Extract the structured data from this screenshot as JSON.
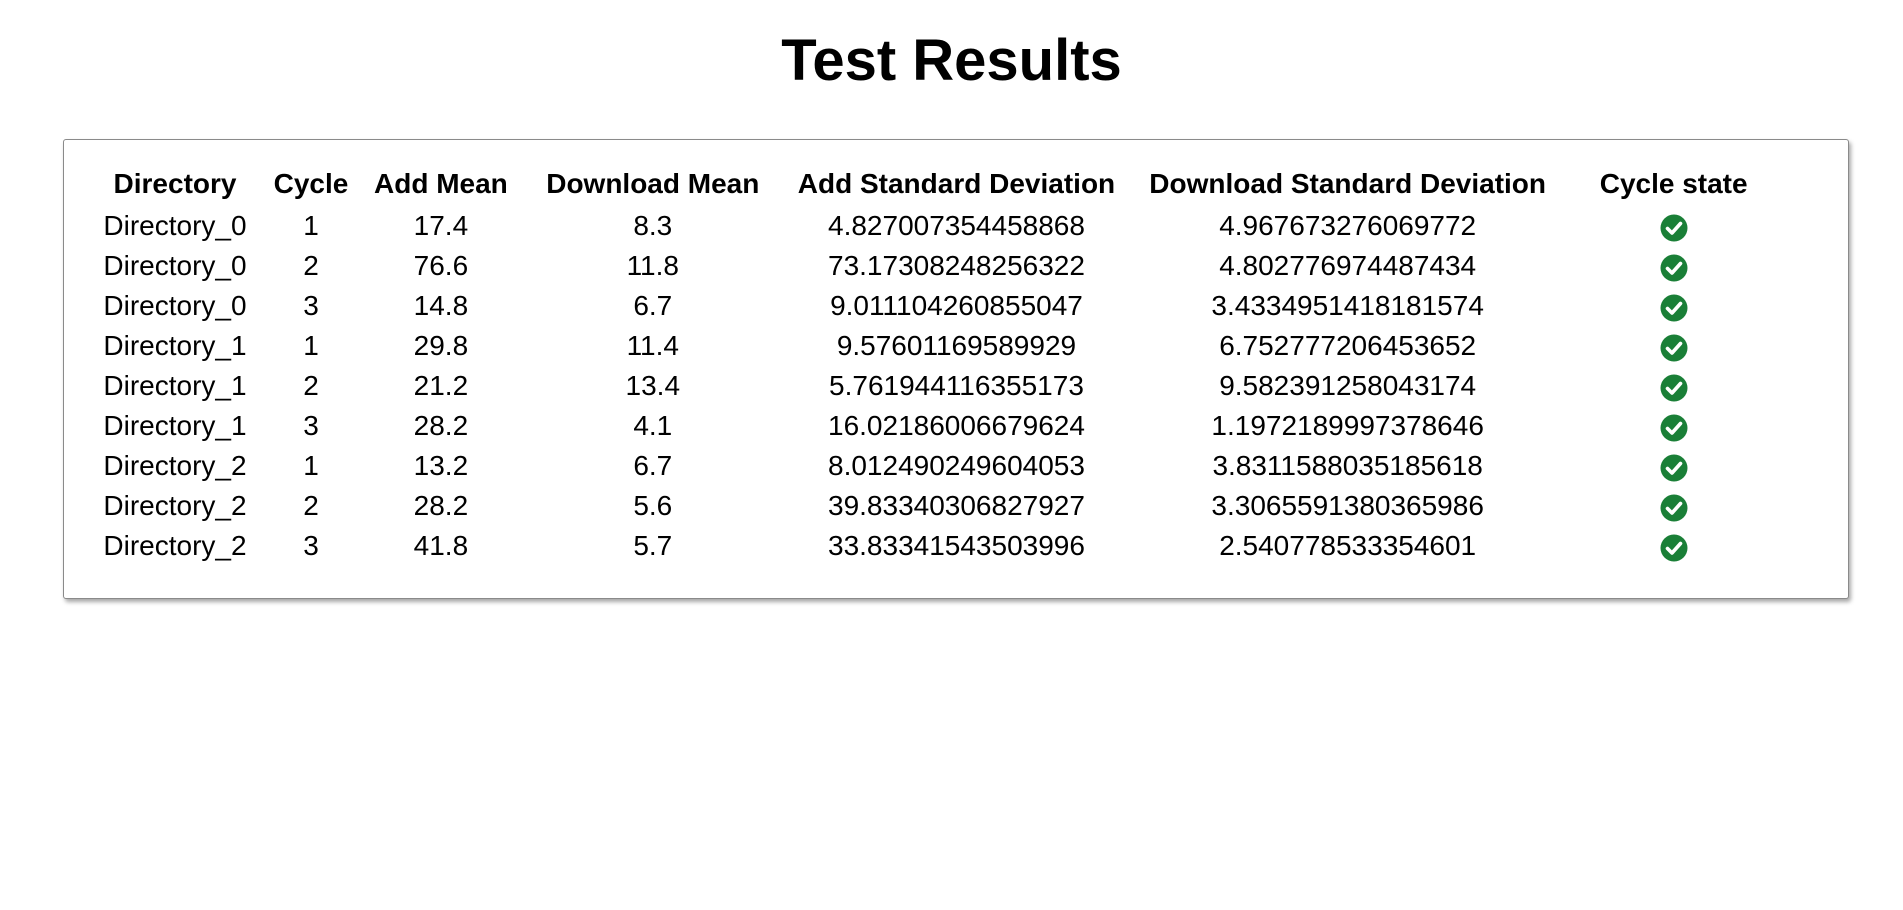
{
  "page": {
    "title": "Test Results"
  },
  "table": {
    "columns": [
      "Directory",
      "Cycle",
      "Add Mean",
      "Download Mean",
      "Add Standard Deviation",
      "Download Standard Deviation",
      "Cycle state"
    ],
    "rows": [
      [
        "Directory_0",
        "1",
        "17.4",
        "8.3",
        "4.827007354458868",
        "4.967673276069772",
        "check-circle-icon"
      ],
      [
        "Directory_0",
        "2",
        "76.6",
        "11.8",
        "73.17308248256322",
        "4.802776974487434",
        "check-circle-icon"
      ],
      [
        "Directory_0",
        "3",
        "14.8",
        "6.7",
        "9.011104260855047",
        "3.4334951418181574",
        "check-circle-icon"
      ],
      [
        "Directory_1",
        "1",
        "29.8",
        "11.4",
        "9.57601169589929",
        "6.752777206453652",
        "check-circle-icon"
      ],
      [
        "Directory_1",
        "2",
        "21.2",
        "13.4",
        "5.761944116355173",
        "9.582391258043174",
        "check-circle-icon"
      ],
      [
        "Directory_1",
        "3",
        "28.2",
        "4.1",
        "16.02186006679624",
        "1.1972189997378646",
        "check-circle-icon"
      ],
      [
        "Directory_2",
        "1",
        "13.2",
        "6.7",
        "8.012490249604053",
        "3.8311588035185618",
        "check-circle-icon"
      ],
      [
        "Directory_2",
        "2",
        "28.2",
        "5.6",
        "39.83340306827927",
        "3.3065591380365986",
        "check-circle-icon"
      ],
      [
        "Directory_2",
        "3",
        "41.8",
        "5.7",
        "33.83341543503996",
        "2.540778533354601",
        "check-circle-icon"
      ]
    ]
  },
  "colors": {
    "success": "#1a7f37"
  }
}
